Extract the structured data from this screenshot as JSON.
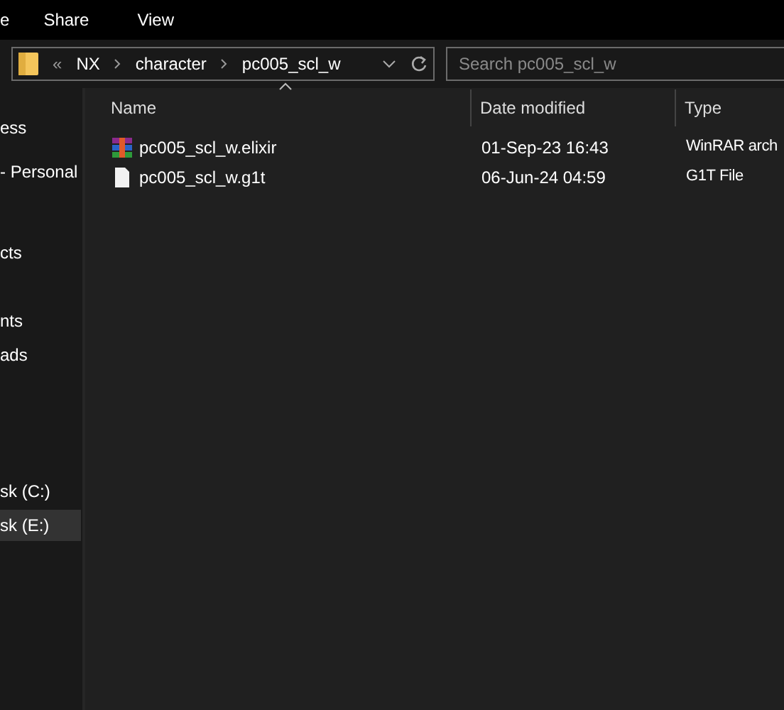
{
  "ribbon_tabs": [
    {
      "label": "e"
    },
    {
      "label": "Share"
    },
    {
      "label": "View"
    }
  ],
  "address_bar": {
    "overflow": "«",
    "path": [
      "NX",
      "character",
      "pc005_scl_w"
    ]
  },
  "search": {
    "placeholder": "Search pc005_scl_w"
  },
  "sidebar": {
    "items": [
      {
        "label": "ess",
        "selected": false
      },
      {
        "label": "- Personal",
        "selected": false
      },
      {
        "label": "cts",
        "selected": false
      },
      {
        "label": "nts",
        "selected": false
      },
      {
        "label": "ads",
        "selected": false
      },
      {
        "label": "sk (C:)",
        "selected": false
      },
      {
        "label": "sk (E:)",
        "selected": true
      }
    ]
  },
  "table": {
    "columns": [
      "Name",
      "Date modified",
      "Type"
    ],
    "rows": [
      {
        "kind": "archive",
        "name": "pc005_scl_w.elixir",
        "date": "01-Sep-23 16:43",
        "type": "WinRAR arch"
      },
      {
        "kind": "file",
        "name": "pc005_scl_w.g1t",
        "date": "06-Jun-24 04:59",
        "type": "G1T File"
      }
    ]
  }
}
